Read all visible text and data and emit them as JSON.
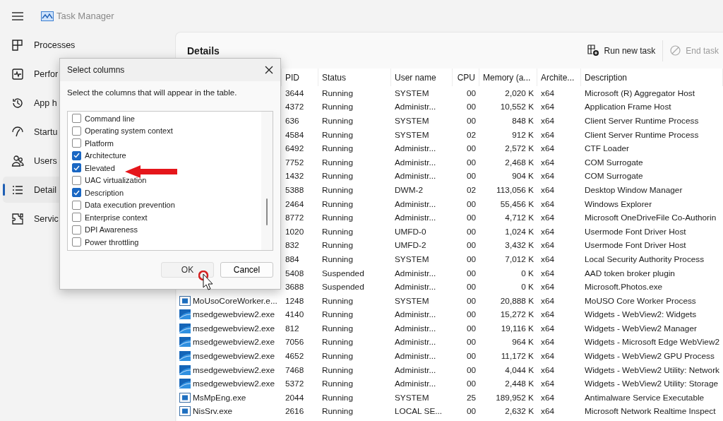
{
  "window": {
    "title": "Task Manager"
  },
  "nav": [
    {
      "label": "Processes",
      "selected": false
    },
    {
      "label": "Perfor",
      "selected": false
    },
    {
      "label": "App h",
      "selected": false
    },
    {
      "label": "Startu",
      "selected": false
    },
    {
      "label": "Users",
      "selected": false
    },
    {
      "label": "Detail",
      "selected": true
    },
    {
      "label": "Servic",
      "selected": false
    }
  ],
  "page": {
    "title": "Details",
    "toolbar": [
      {
        "label": "Run new task",
        "disabled": false
      },
      {
        "label": "End task",
        "disabled": true
      }
    ]
  },
  "table": {
    "columns": [
      "PID",
      "Status",
      "User name",
      "CPU",
      "Memory (a...",
      "Archite...",
      "Description"
    ],
    "rows": [
      {
        "pid": "3644",
        "status": "Running",
        "user": "SYSTEM",
        "cpu": "00",
        "memory": "2,020 K",
        "arch": "x64",
        "description": "Microsoft (R) Aggregator Host"
      },
      {
        "pid": "4372",
        "status": "Running",
        "user": "Administr...",
        "cpu": "00",
        "memory": "10,552 K",
        "arch": "x64",
        "description": "Application Frame Host"
      },
      {
        "pid": "636",
        "status": "Running",
        "user": "SYSTEM",
        "cpu": "00",
        "memory": "848 K",
        "arch": "x64",
        "description": "Client Server Runtime Process"
      },
      {
        "pid": "4584",
        "status": "Running",
        "user": "SYSTEM",
        "cpu": "02",
        "memory": "912 K",
        "arch": "x64",
        "description": "Client Server Runtime Process"
      },
      {
        "pid": "6492",
        "status": "Running",
        "user": "Administr...",
        "cpu": "00",
        "memory": "2,572 K",
        "arch": "x64",
        "description": "CTF Loader"
      },
      {
        "pid": "7752",
        "status": "Running",
        "user": "Administr...",
        "cpu": "00",
        "memory": "2,468 K",
        "arch": "x64",
        "description": "COM Surrogate"
      },
      {
        "pid": "1432",
        "status": "Running",
        "user": "Administr...",
        "cpu": "00",
        "memory": "904 K",
        "arch": "x64",
        "description": "COM Surrogate"
      },
      {
        "pid": "5388",
        "status": "Running",
        "user": "DWM-2",
        "cpu": "02",
        "memory": "113,056 K",
        "arch": "x64",
        "description": "Desktop Window Manager"
      },
      {
        "pid": "2464",
        "status": "Running",
        "user": "Administr...",
        "cpu": "00",
        "memory": "55,456 K",
        "arch": "x64",
        "description": "Windows Explorer"
      },
      {
        "pid": "8772",
        "status": "Running",
        "user": "Administr...",
        "cpu": "00",
        "memory": "4,712 K",
        "arch": "x64",
        "description": "Microsoft OneDriveFile Co-Authorin"
      },
      {
        "pid": "1020",
        "status": "Running",
        "user": "UMFD-0",
        "cpu": "00",
        "memory": "1,024 K",
        "arch": "x64",
        "description": "Usermode Font Driver Host"
      },
      {
        "pid": "832",
        "status": "Running",
        "user": "UMFD-2",
        "cpu": "00",
        "memory": "3,432 K",
        "arch": "x64",
        "description": "Usermode Font Driver Host"
      },
      {
        "pid": "884",
        "status": "Running",
        "user": "SYSTEM",
        "cpu": "00",
        "memory": "7,012 K",
        "arch": "x64",
        "description": "Local Security Authority Process"
      },
      {
        "pid": "5408",
        "status": "Suspended",
        "user": "Administr...",
        "cpu": "00",
        "memory": "0 K",
        "arch": "x64",
        "description": "AAD token broker plugin"
      },
      {
        "pid": "3688",
        "status": "Suspended",
        "user": "Administr...",
        "cpu": "00",
        "memory": "0 K",
        "arch": "x64",
        "description": "Microsoft.Photos.exe"
      },
      {
        "name": "MoUsoCoreWorker.e...",
        "kind": "app",
        "pid": "1248",
        "status": "Running",
        "user": "SYSTEM",
        "cpu": "00",
        "memory": "20,888 K",
        "arch": "x64",
        "description": "MoUSO Core Worker Process"
      },
      {
        "name": "msedgewebview2.exe",
        "kind": "webview",
        "pid": "4140",
        "status": "Running",
        "user": "Administr...",
        "cpu": "00",
        "memory": "15,272 K",
        "arch": "x64",
        "description": "Widgets - WebView2: Widgets"
      },
      {
        "name": "msedgewebview2.exe",
        "kind": "webview",
        "pid": "812",
        "status": "Running",
        "user": "Administr...",
        "cpu": "00",
        "memory": "19,116 K",
        "arch": "x64",
        "description": "Widgets - WebView2 Manager"
      },
      {
        "name": "msedgewebview2.exe",
        "kind": "webview",
        "pid": "7056",
        "status": "Running",
        "user": "Administr...",
        "cpu": "00",
        "memory": "964 K",
        "arch": "x64",
        "description": "Widgets - Microsoft Edge WebView2"
      },
      {
        "name": "msedgewebview2.exe",
        "kind": "webview",
        "pid": "4652",
        "status": "Running",
        "user": "Administr...",
        "cpu": "00",
        "memory": "11,172 K",
        "arch": "x64",
        "description": "Widgets - WebView2 GPU Process"
      },
      {
        "name": "msedgewebview2.exe",
        "kind": "webview",
        "pid": "7468",
        "status": "Running",
        "user": "Administr...",
        "cpu": "00",
        "memory": "4,044 K",
        "arch": "x64",
        "description": "Widgets - WebView2 Utility: Network"
      },
      {
        "name": "msedgewebview2.exe",
        "kind": "webview",
        "pid": "5372",
        "status": "Running",
        "user": "Administr...",
        "cpu": "00",
        "memory": "2,448 K",
        "arch": "x64",
        "description": "Widgets - WebView2 Utility: Storage"
      },
      {
        "name": "MsMpEng.exe",
        "kind": "app",
        "pid": "2044",
        "status": "Running",
        "user": "SYSTEM",
        "cpu": "25",
        "memory": "189,952 K",
        "arch": "x64",
        "description": "Antimalware Service Executable"
      },
      {
        "name": "NisSrv.exe",
        "kind": "app",
        "pid": "2616",
        "status": "Running",
        "user": "LOCAL SE...",
        "cpu": "00",
        "memory": "2,632 K",
        "arch": "x64",
        "description": "Microsoft Network Realtime Inspect"
      }
    ]
  },
  "dialog": {
    "title": "Select columns",
    "prompt": "Select the columns that will appear in the table.",
    "options": [
      {
        "label": "Command line",
        "checked": false
      },
      {
        "label": "Operating system context",
        "checked": false
      },
      {
        "label": "Platform",
        "checked": false
      },
      {
        "label": "Architecture",
        "checked": true
      },
      {
        "label": "Elevated",
        "checked": true
      },
      {
        "label": "UAC virtualization",
        "checked": false
      },
      {
        "label": "Description",
        "checked": true
      },
      {
        "label": "Data execution prevention",
        "checked": false
      },
      {
        "label": "Enterprise context",
        "checked": false
      },
      {
        "label": "DPI Awareness",
        "checked": false
      },
      {
        "label": "Power throttling",
        "checked": false
      }
    ],
    "buttons": [
      "OK",
      "Cancel"
    ]
  }
}
